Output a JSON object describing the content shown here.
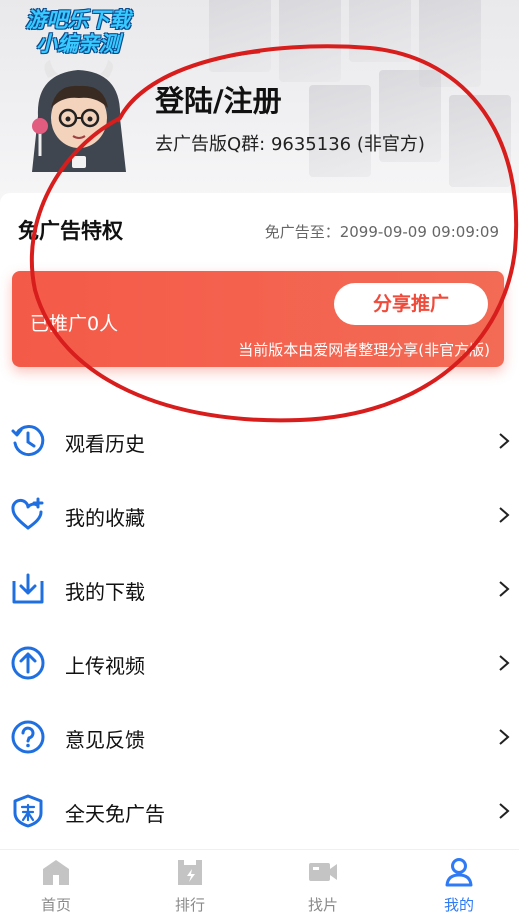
{
  "watermark": {
    "line1": "游吧乐下载",
    "line2": "小编亲测"
  },
  "profile": {
    "title": "登陆/注册",
    "subtitle": "去广告版Q群: 9635136 (非官方)"
  },
  "ad_free": {
    "title": "免广告特权",
    "expire_text": "免广告至：2099-09-09 09:09:09",
    "promoted_count": "已推广0人",
    "share_button": "分享推广",
    "note": "当前版本由爱网者整理分享(非官方版)"
  },
  "menu": {
    "items": [
      {
        "label": "观看历史",
        "icon": "history-icon"
      },
      {
        "label": "我的收藏",
        "icon": "favorite-heart-icon"
      },
      {
        "label": "我的下载",
        "icon": "download-icon"
      },
      {
        "label": "上传视频",
        "icon": "upload-icon"
      },
      {
        "label": "意见反馈",
        "icon": "help-question-icon"
      },
      {
        "label": "全天免广告",
        "icon": "ad-free-icon"
      }
    ]
  },
  "tabs": [
    {
      "label": "首页",
      "icon": "home-icon",
      "active": false
    },
    {
      "label": "排行",
      "icon": "ranking-icon",
      "active": false
    },
    {
      "label": "找片",
      "icon": "video-camera-icon",
      "active": false
    },
    {
      "label": "我的",
      "icon": "user-icon",
      "active": true
    }
  ],
  "colors": {
    "accent_blue": "#1f6fe0",
    "promo_red": "#f45a48",
    "tab_active": "#2f7bf5",
    "annotation_red": "#d81d1d"
  }
}
